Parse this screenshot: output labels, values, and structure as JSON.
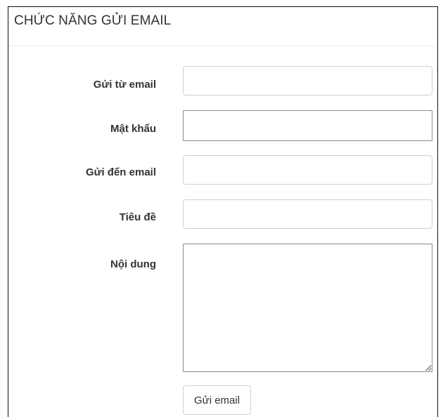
{
  "panel": {
    "title": "CHỨC NĂNG GỬI EMAIL"
  },
  "form": {
    "fields": [
      {
        "label": "Gửi từ email",
        "value": "",
        "placeholder": ""
      },
      {
        "label": "Mật khẩu",
        "value": "",
        "placeholder": ""
      },
      {
        "label": "Gửi đến email",
        "value": "",
        "placeholder": ""
      },
      {
        "label": "Tiêu đề",
        "value": "",
        "placeholder": ""
      },
      {
        "label": "Nội dung",
        "value": "",
        "placeholder": ""
      }
    ],
    "submit_label": "Gửi email"
  }
}
